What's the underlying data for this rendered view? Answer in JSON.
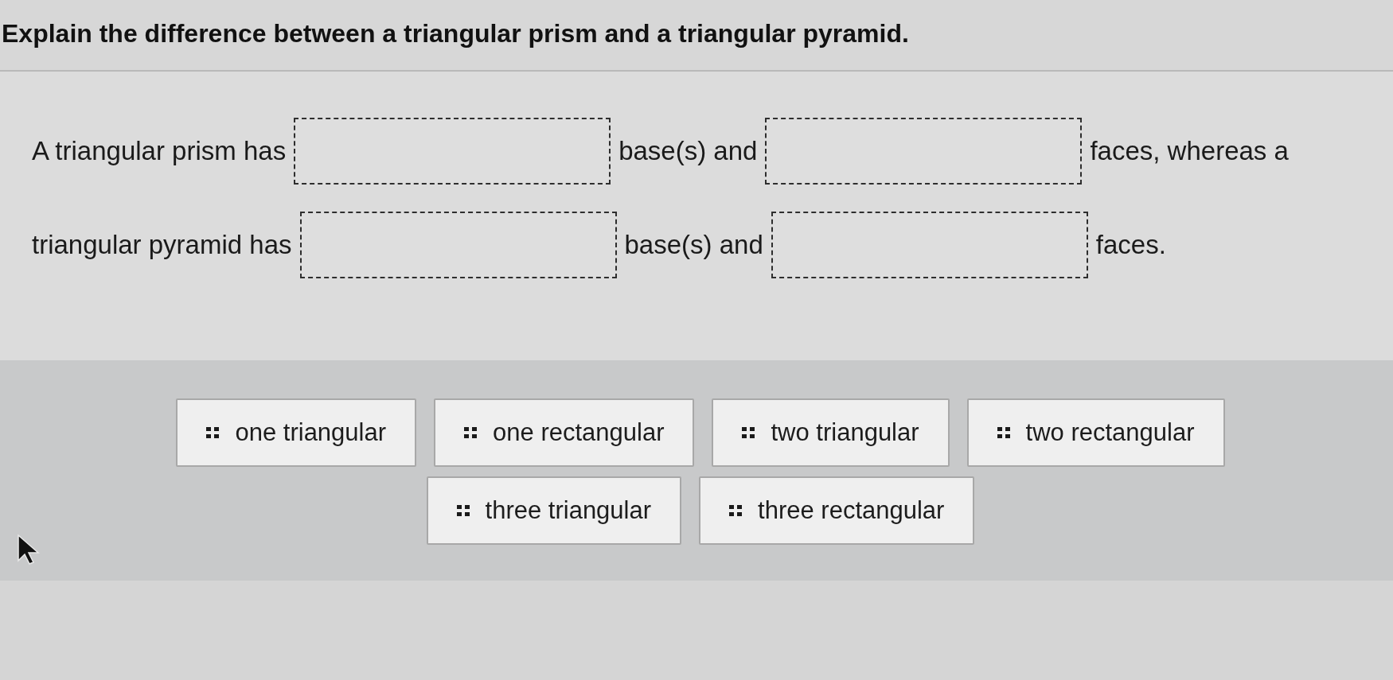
{
  "question": {
    "title": "Explain the difference between a triangular prism and a triangular pyramid."
  },
  "lines": [
    [
      {
        "kind": "text",
        "text": "A triangular prism has"
      },
      {
        "kind": "blank"
      },
      {
        "kind": "text",
        "text": "base(s) and"
      },
      {
        "kind": "blank"
      },
      {
        "kind": "text",
        "text": "faces, whereas a"
      }
    ],
    [
      {
        "kind": "text",
        "text": "triangular pyramid has"
      },
      {
        "kind": "blank"
      },
      {
        "kind": "text",
        "text": "base(s) and"
      },
      {
        "kind": "blank"
      },
      {
        "kind": "text",
        "text": "faces."
      }
    ]
  ],
  "choices": [
    {
      "label": "one triangular"
    },
    {
      "label": "one rectangular"
    },
    {
      "label": "two triangular"
    },
    {
      "label": "two rectangular"
    },
    {
      "label": "three triangular"
    },
    {
      "label": "three rectangular"
    }
  ]
}
